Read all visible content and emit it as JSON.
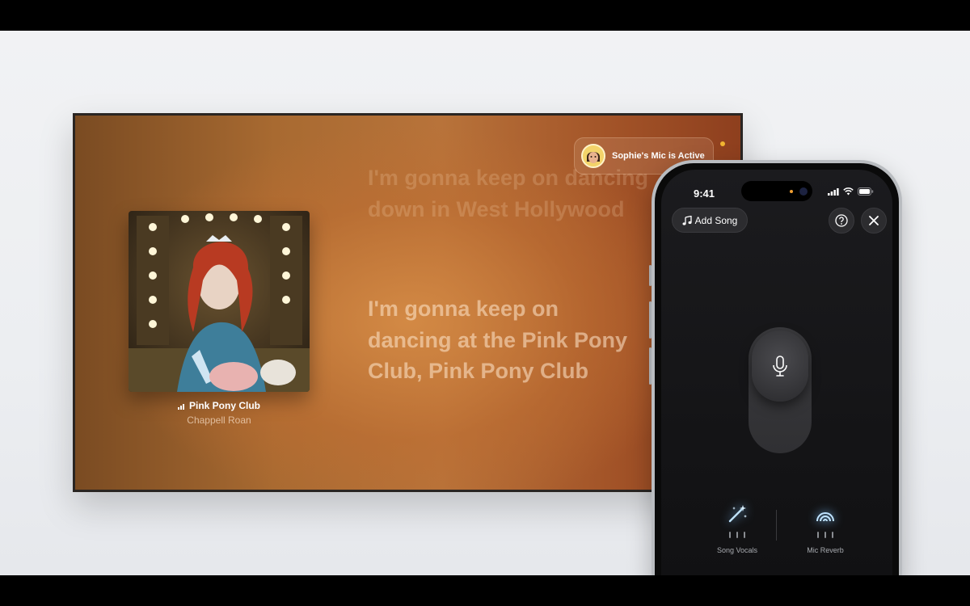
{
  "tv": {
    "now_playing": {
      "title": "Pink Pony Club",
      "artist": "Chappell Roan"
    },
    "lyrics": {
      "previous": "I'm gonna keep on dancing down in West Hollywood",
      "current_lines": [
        "I'm gonna keep on",
        "dancing at the Pink Pony",
        "Club, Pink Pony Club"
      ]
    },
    "mic_status": "Sophie's Mic is Active"
  },
  "phone": {
    "status_bar": {
      "time": "9:41"
    },
    "add_song_label": "Add Song",
    "controls": [
      {
        "label": "Song Vocals",
        "icon": "magic-wand-icon"
      },
      {
        "label": "Mic Reverb",
        "icon": "reverb-icon"
      }
    ]
  },
  "colors": {
    "tv_bg_warm": "#b8733a",
    "phone_bg": "#141416",
    "accent_glow": "#9fd4ff"
  }
}
